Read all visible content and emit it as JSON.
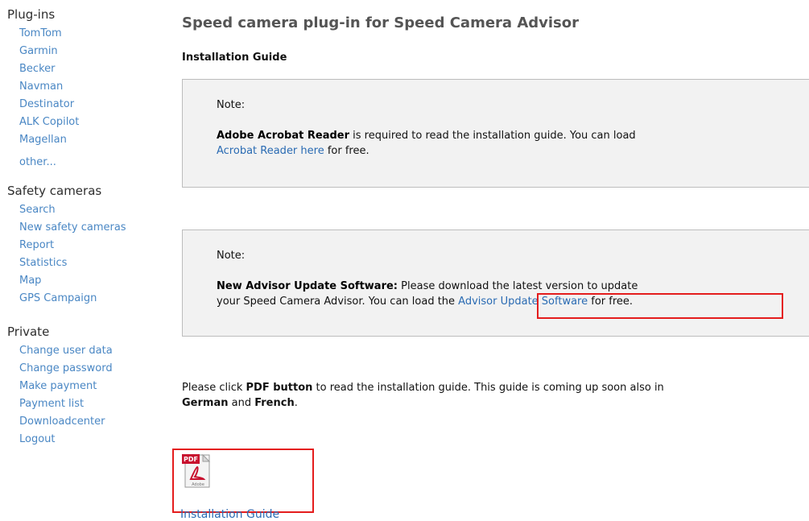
{
  "sidebar": {
    "plugins": {
      "title": "Plug-ins",
      "items": [
        "TomTom",
        "Garmin",
        "Becker",
        "Navman",
        "Destinator",
        "ALK Copilot",
        "Magellan"
      ],
      "other": "other..."
    },
    "safety": {
      "title": "Safety cameras",
      "items": [
        "Search",
        "New safety cameras",
        "Report",
        "Statistics",
        "Map",
        "GPS Campaign"
      ]
    },
    "private": {
      "title": "Private",
      "items": [
        "Change user data",
        "Change password",
        "Make payment",
        "Payment list",
        "Downloadcenter",
        "Logout"
      ]
    }
  },
  "main": {
    "title": "Speed camera plug-in for Speed Camera Advisor",
    "subtitle": "Installation Guide",
    "note1": {
      "label": "Note:",
      "bold": "Adobe Acrobat Reader",
      "text1": " is required to read the installation guide. You can load",
      "link": "Acrobat Reader here",
      "text2": " for free."
    },
    "note2": {
      "label": "Note:",
      "bold": "New Advisor Update Software:",
      "text1": " Please download the latest version to update",
      "text2": "your Speed Camera Advisor. You can load the ",
      "link": "Advisor Update Software",
      "text3": " for free."
    },
    "para": {
      "t1": "Please click ",
      "b1": "PDF button",
      "t2": " to read the installation guide. This guide is coming up soon also in",
      "b2": "German",
      "t3": " and ",
      "b3": "French",
      "t4": "."
    },
    "pdf": {
      "icon_label": "PDF",
      "icon_sub": "Adobe",
      "link": "Installation Guide"
    }
  }
}
